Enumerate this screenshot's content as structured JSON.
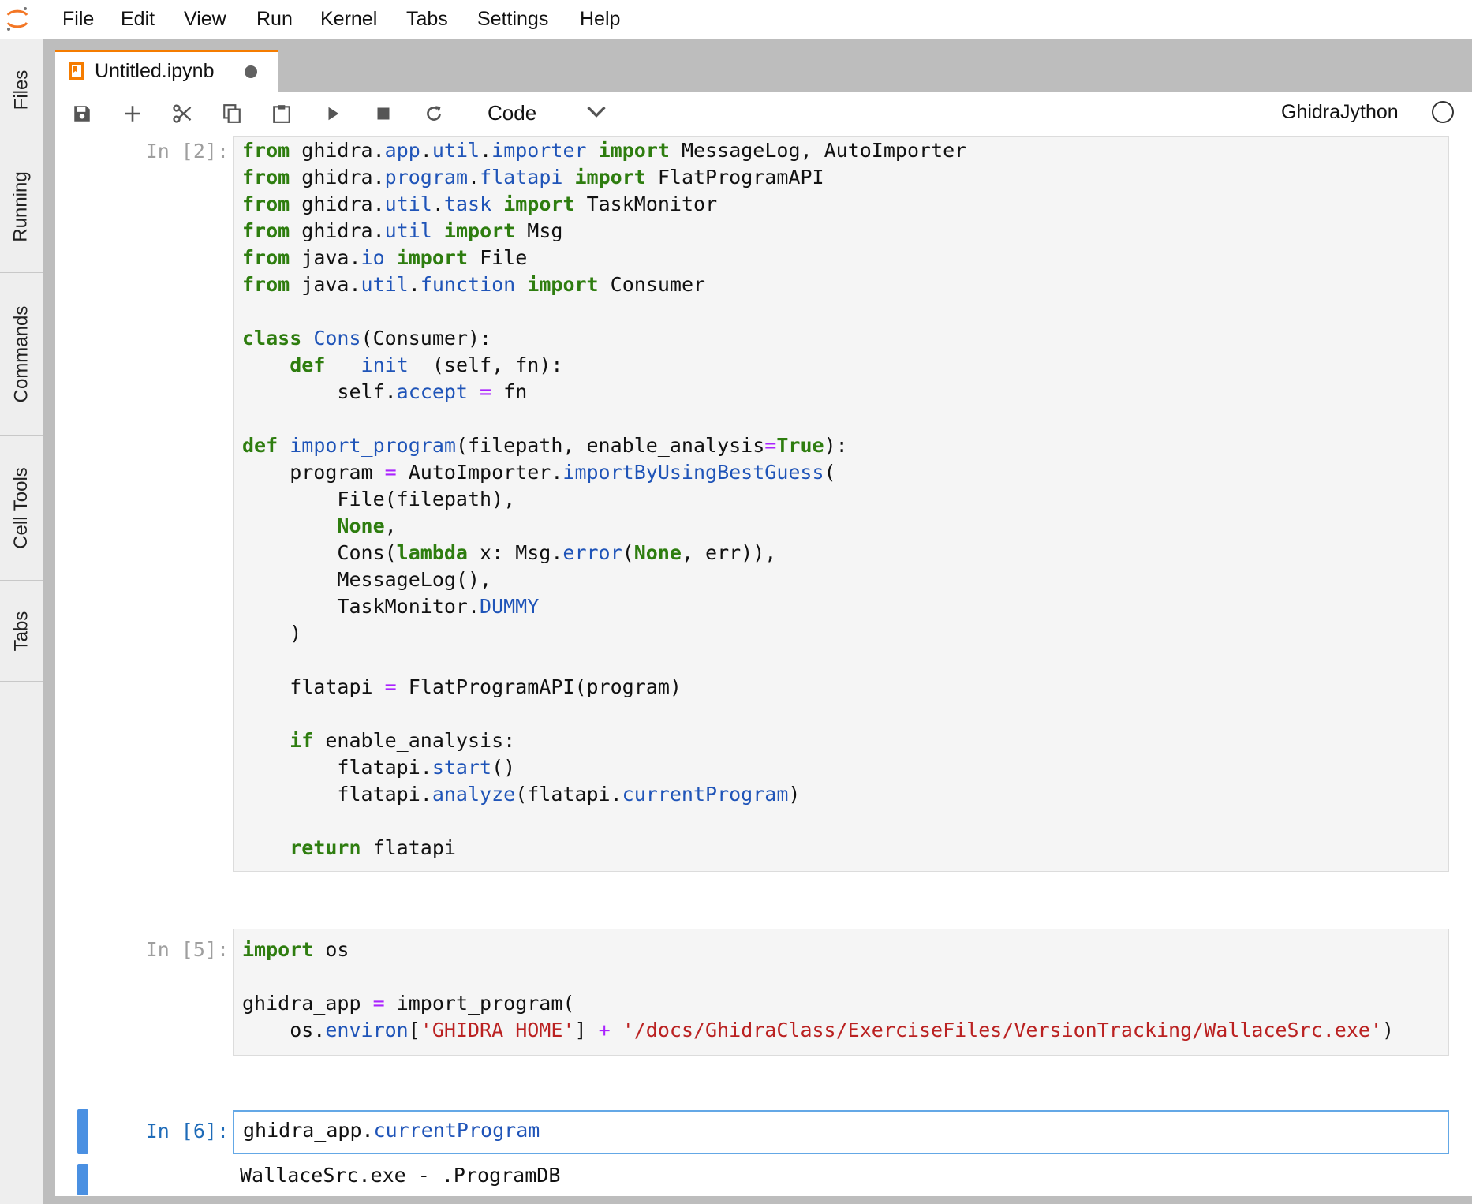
{
  "menu": [
    "File",
    "Edit",
    "View",
    "Run",
    "Kernel",
    "Tabs",
    "Settings",
    "Help"
  ],
  "sidebar": [
    "Files",
    "Running",
    "Commands",
    "Cell Tools",
    "Tabs"
  ],
  "tab": {
    "title": "Untitled.ipynb",
    "dirty": true
  },
  "toolbar": {
    "icons": [
      "save-icon",
      "add-icon",
      "cut-icon",
      "copy-icon",
      "paste-icon",
      "run-icon",
      "stop-icon",
      "restart-icon"
    ],
    "cell_type": "Code",
    "kernel": "GhidraJython"
  },
  "cells": [
    {
      "prompt": "In [2]:",
      "code": "from ghidra.app.util.importer import MessageLog, AutoImporter\nfrom ghidra.program.flatapi import FlatProgramAPI\nfrom ghidra.util.task import TaskMonitor\nfrom ghidra.util import Msg\nfrom java.io import File\nfrom java.util.function import Consumer\n\nclass Cons(Consumer):\n    def __init__(self, fn):\n        self.accept = fn\n\ndef import_program(filepath, enable_analysis=True):\n    program = AutoImporter.importByUsingBestGuess(\n        File(filepath),\n        None,\n        Cons(lambda x: Msg.error(None, err)),\n        MessageLog(),\n        TaskMonitor.DUMMY\n    )\n\n    flatapi = FlatProgramAPI(program)\n\n    if enable_analysis:\n        flatapi.start()\n        flatapi.analyze(flatapi.currentProgram)\n\n    return flatapi"
    },
    {
      "prompt": "In [5]:",
      "code": "import os\n\nghidra_app = import_program(\n    os.environ['GHIDRA_HOME'] + '/docs/GhidraClass/ExerciseFiles/VersionTracking/WallaceSrc.exe')"
    },
    {
      "prompt": "In [6]:",
      "code": "ghidra_app.currentProgram",
      "output": "WallaceSrc.exe - .ProgramDB"
    }
  ],
  "colors": {
    "accent": "#f57c00",
    "keyword": "#2e7d0f",
    "attribute": "#1f54b8",
    "operator": "#aa22ff",
    "string": "#ba2121",
    "active_cell_border": "#64a8e6",
    "collapser": "#4a90e2"
  }
}
